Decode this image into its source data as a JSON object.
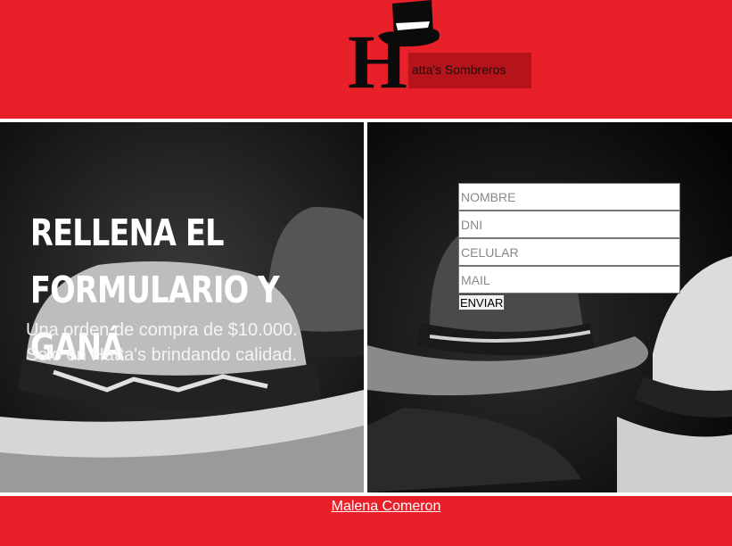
{
  "brand": {
    "logo_letter": "H",
    "logo_text": "atta's Sombreros",
    "colors": {
      "primary_red": "#e8202a",
      "dark_red": "#b5141b",
      "black": "#0b0b0b",
      "white": "#ffffff"
    }
  },
  "promo": {
    "title": "RELLENA EL FORMULARIO Y GANÁ",
    "line1": "Una orden de compra de $10.000.",
    "line2": "Solo en Hatta's brindando calidad."
  },
  "form": {
    "fields": [
      {
        "placeholder": "NOMBRE"
      },
      {
        "placeholder": "DNI"
      },
      {
        "placeholder": "CELULAR"
      },
      {
        "placeholder": "MAIL"
      }
    ],
    "submit_label": "ENVIAR"
  },
  "footer": {
    "author_link": "Malena Comeron"
  },
  "icons": {
    "logo": "top-hat-icon"
  }
}
